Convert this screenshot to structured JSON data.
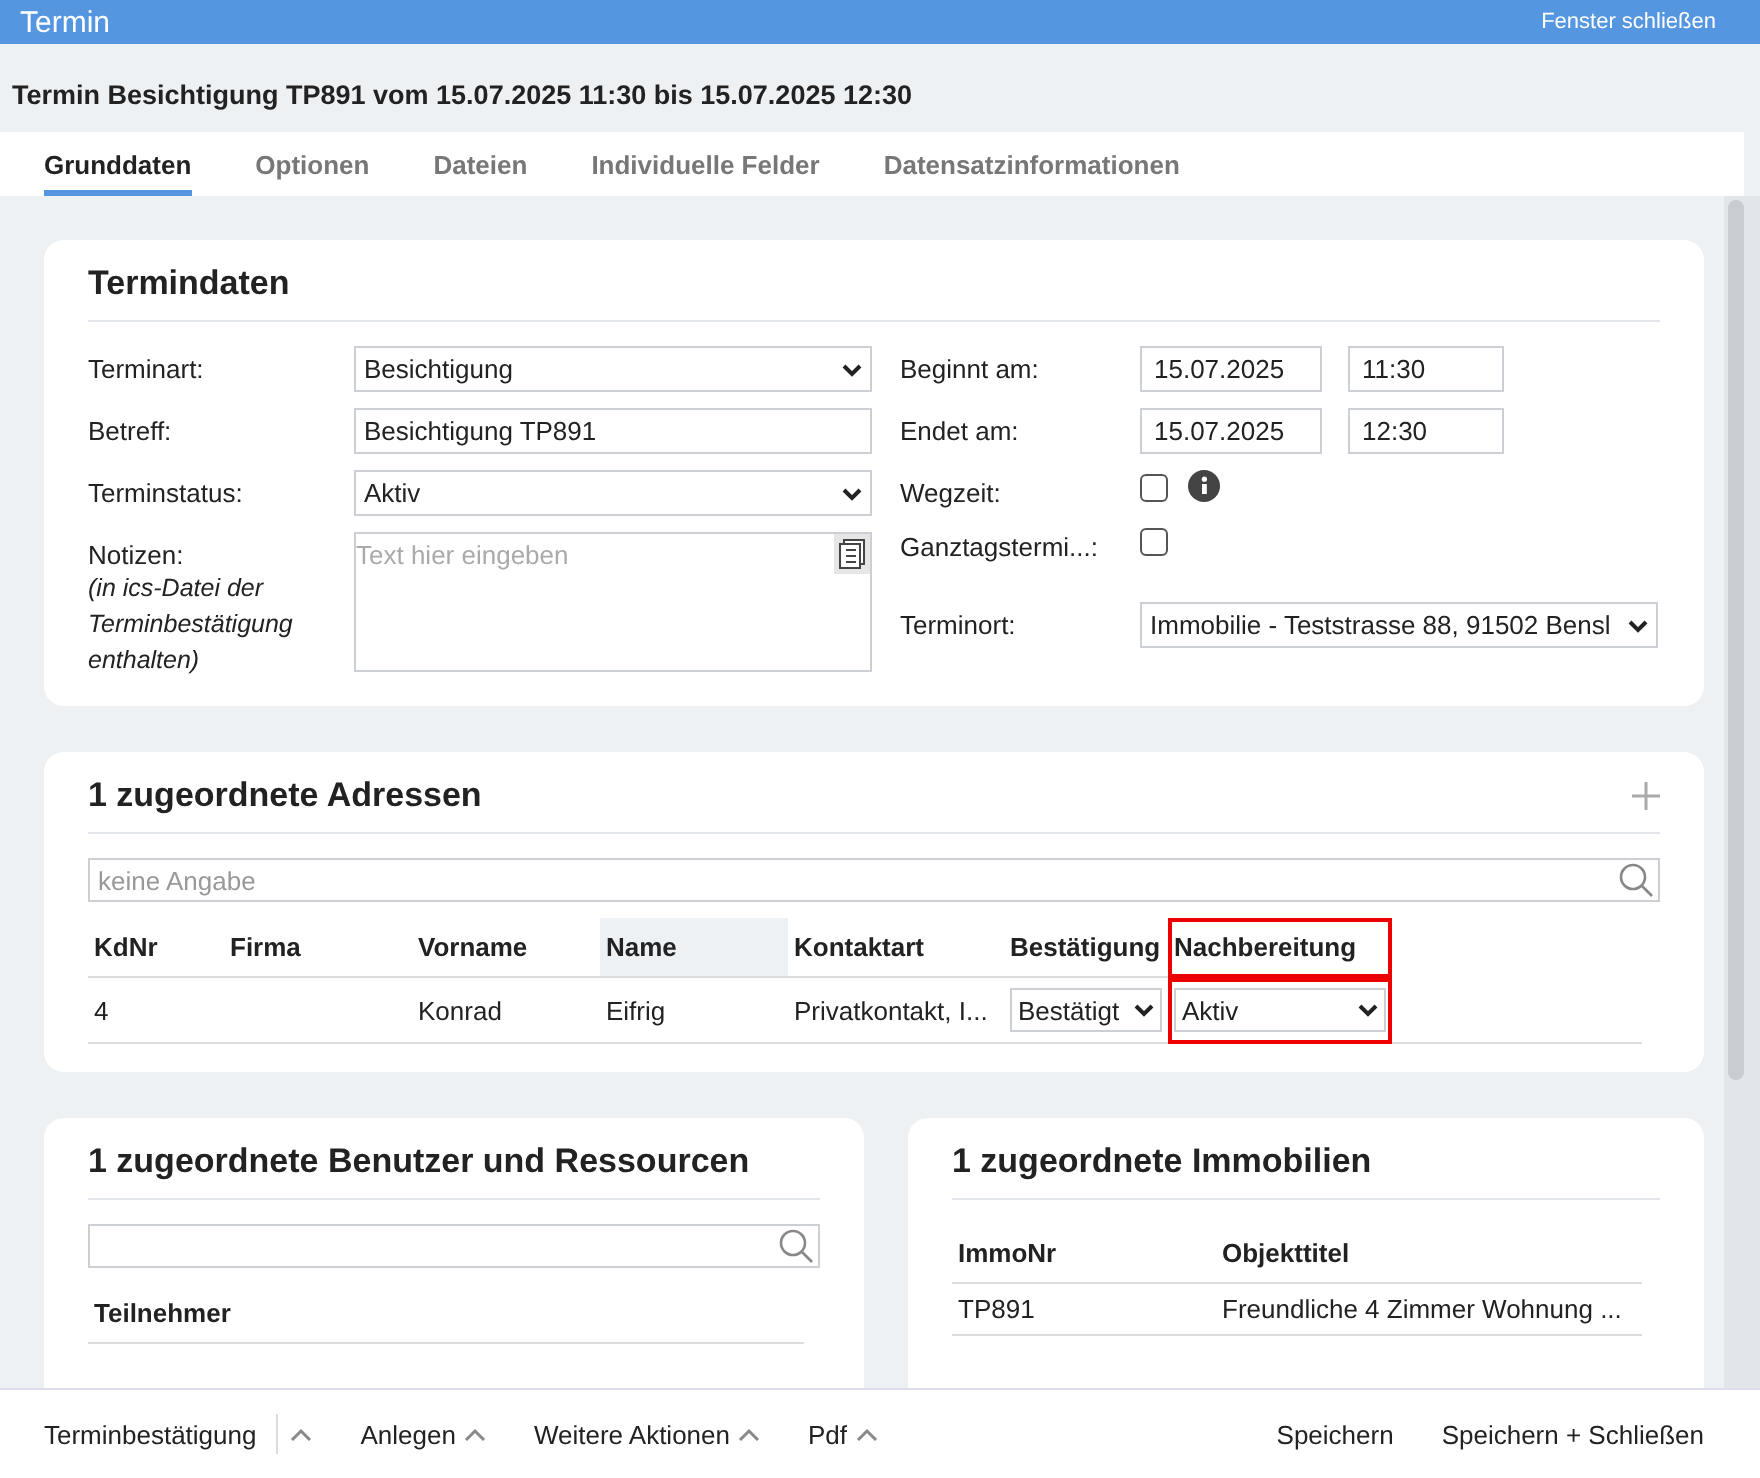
{
  "window": {
    "title": "Termin",
    "close_link": "Fenster schließen"
  },
  "heading": "Termin Besichtigung TP891 vom 15.07.2025 11:30 bis 15.07.2025 12:30",
  "tabs": [
    {
      "label": "Grunddaten",
      "selected": true
    },
    {
      "label": "Optionen",
      "selected": false
    },
    {
      "label": "Dateien",
      "selected": false
    },
    {
      "label": "Individuelle Felder",
      "selected": false
    },
    {
      "label": "Datensatzinformationen",
      "selected": false
    }
  ],
  "termindaten": {
    "title": "Termindaten",
    "left": [
      {
        "kind": "select",
        "label": "Terminart:",
        "value": "Besichtigung"
      },
      {
        "kind": "input",
        "label": "Betreff:",
        "value": "Besichtigung TP891"
      },
      {
        "kind": "select",
        "label": "Terminstatus:",
        "value": "Aktiv"
      },
      {
        "kind": "textarea",
        "label": "Notizen:",
        "note": "(in ics-Datei der Terminbestätigung enthalten)",
        "placeholder": "Text hier eingeben"
      }
    ],
    "right": [
      {
        "kind": "datetime",
        "label": "Beginnt am:",
        "date": "15.07.2025",
        "time": "11:30"
      },
      {
        "kind": "datetime",
        "label": "Endet am:",
        "date": "15.07.2025",
        "time": "12:30"
      },
      {
        "kind": "checkbox",
        "label": "Wegzeit:",
        "checked": false,
        "info": true
      },
      {
        "kind": "checkbox",
        "label": "Ganztagstermi...:",
        "checked": false,
        "info": false
      },
      {
        "kind": "select",
        "label": "Terminort:",
        "value": "Immobilie - Teststrasse 88, 91502 Bensl"
      }
    ]
  },
  "adressen": {
    "title": "1 zugeordnete Adressen",
    "search_placeholder": "keine Angabe",
    "columns": [
      {
        "label": "KdNr",
        "sorted": false,
        "highlighted": false
      },
      {
        "label": "Firma",
        "sorted": false,
        "highlighted": false
      },
      {
        "label": "Vorname",
        "sorted": false,
        "highlighted": false
      },
      {
        "label": "Name",
        "sorted": true,
        "highlighted": false
      },
      {
        "label": "Kontaktart",
        "sorted": false,
        "highlighted": false
      },
      {
        "label": "Bestätigung",
        "sorted": false,
        "highlighted": false
      },
      {
        "label": "Nachbereitung",
        "sorted": false,
        "highlighted": true
      }
    ],
    "rows": [
      [
        {
          "kind": "text",
          "value": "4"
        },
        {
          "kind": "empty"
        },
        {
          "kind": "text",
          "value": "Konrad"
        },
        {
          "kind": "text",
          "value": "Eifrig"
        },
        {
          "kind": "text",
          "value": "Privatkontakt, I..."
        },
        {
          "kind": "select",
          "value": "Bestätigt"
        },
        {
          "kind": "select",
          "value": "Aktiv"
        }
      ]
    ]
  },
  "benutzer": {
    "title": "1 zugeordnete Benutzer und Ressourcen",
    "columns": [
      "Teilnehmer"
    ]
  },
  "immobilien": {
    "title": "1 zugeordnete Immobilien",
    "columns": [
      "ImmoNr",
      "Objekttitel"
    ],
    "rows": [
      [
        "TP891",
        "Freundliche 4 Zimmer Wohnung ..."
      ]
    ]
  },
  "footer": {
    "left": [
      {
        "label": "Terminbestätigung",
        "separator": true
      },
      {
        "label": "Anlegen",
        "separator": false
      },
      {
        "label": "Weitere Aktionen",
        "separator": false
      },
      {
        "label": "Pdf",
        "separator": false
      }
    ],
    "right": [
      "Speichern",
      "Speichern + Schließen"
    ]
  }
}
